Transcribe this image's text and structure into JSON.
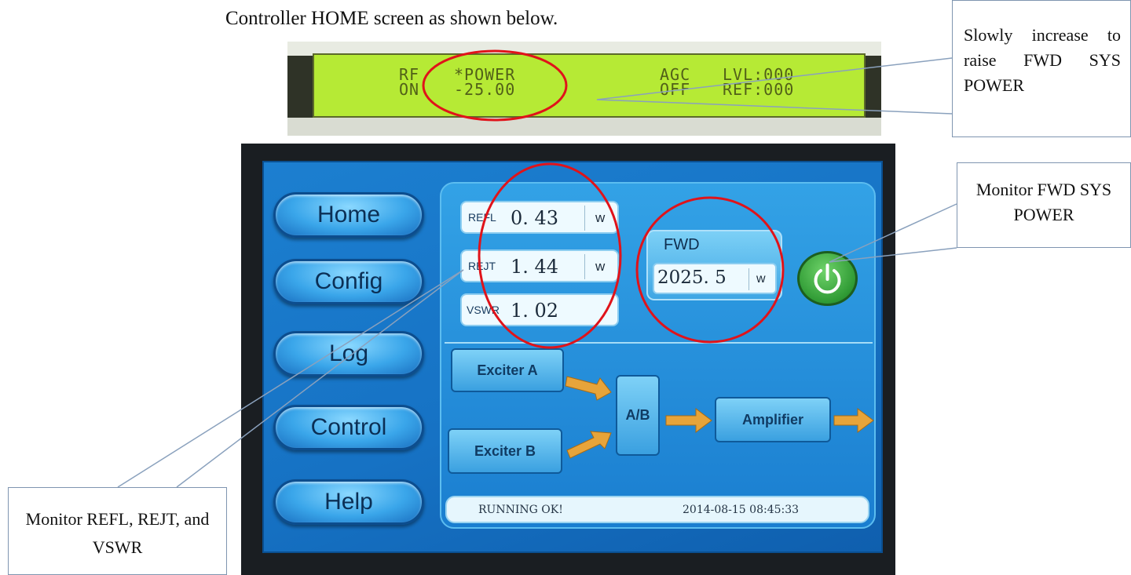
{
  "caption": "Controller HOME screen as shown below.",
  "lcd": {
    "rf": "RF",
    "on": "ON",
    "power_label": "*POWER",
    "power_value": "-25.00",
    "agc": "AGC",
    "off": "OFF",
    "lvl": "LVL:000",
    "ref": "REF:000"
  },
  "nav": {
    "home": "Home",
    "config": "Config",
    "log": "Log",
    "control": "Control",
    "help": "Help"
  },
  "meters": {
    "refl": {
      "label": "REFL",
      "value": "0. 43",
      "unit": "w"
    },
    "rejt": {
      "label": "REJT",
      "value": "1. 44",
      "unit": "w"
    },
    "vswr": {
      "label": "VSWR",
      "value": "1. 02"
    },
    "fwd": {
      "label": "FWD",
      "value": "2025. 5",
      "unit": "w"
    }
  },
  "blocks": {
    "exciter_a": "Exciter A",
    "exciter_b": "Exciter B",
    "ab": "A/B",
    "amplifier": "Amplifier"
  },
  "status": {
    "message": "RUNNING OK!",
    "datetime": "2014-08-15 08:45:33"
  },
  "callouts": {
    "increase": "Slowly increase to raise FWD SYS POWER",
    "monitor_fwd": "Monitor FWD SYS POWER",
    "monitor_refl": "Monitor REFL, REJT, and VSWR"
  },
  "colors": {
    "lcd_green": "#b6ea35",
    "screen_blue": "#1672c4",
    "highlight_red": "#e0131a",
    "power_green": "#2f9a34"
  }
}
